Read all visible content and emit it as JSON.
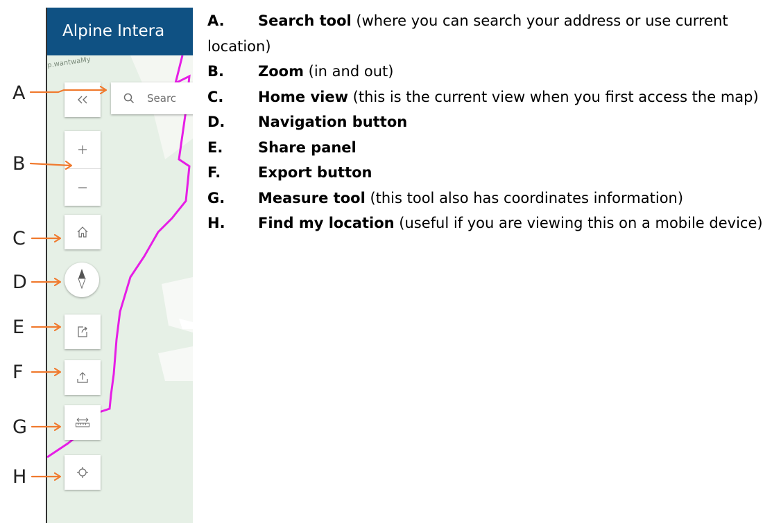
{
  "app": {
    "title": "Alpine Intera",
    "search_placeholder": "Searc",
    "road_label": "p.wantwaMy"
  },
  "callouts": [
    "A",
    "B",
    "C",
    "D",
    "E",
    "F",
    "G",
    "H"
  ],
  "legend": [
    {
      "key": "A.",
      "name": "Search tool",
      "desc": " (where you can search your address or use current location)"
    },
    {
      "key": "B.",
      "name": "Zoom",
      "desc": " (in and out)"
    },
    {
      "key": "C.",
      "name": "Home view",
      "desc": " (this is the current view when you first access the map)"
    },
    {
      "key": "D.",
      "name": "Navigation button",
      "desc": ""
    },
    {
      "key": "E.",
      "name": "Share panel",
      "desc": ""
    },
    {
      "key": "F.",
      "name": "Export button",
      "desc": ""
    },
    {
      "key": "G.",
      "name": "Measure tool",
      "desc": " (this tool also has coordinates information)"
    },
    {
      "key": "H.",
      "name": "Find my location",
      "desc": " (useful if you are viewing this on a mobile device)"
    }
  ],
  "icons": {
    "collapse": "double-chevron-left-icon",
    "search": "search-icon",
    "zoom_in": "plus-icon",
    "zoom_out": "minus-icon",
    "home": "home-icon",
    "compass": "compass-icon",
    "share": "share-icon",
    "export": "export-icon",
    "measure": "measure-icon",
    "locate": "crosshair-icon"
  },
  "colors": {
    "header": "#0f5183",
    "map_background": "#e6f0e6",
    "boundary_line": "#e61ee6",
    "arrow": "#f07a2e"
  }
}
